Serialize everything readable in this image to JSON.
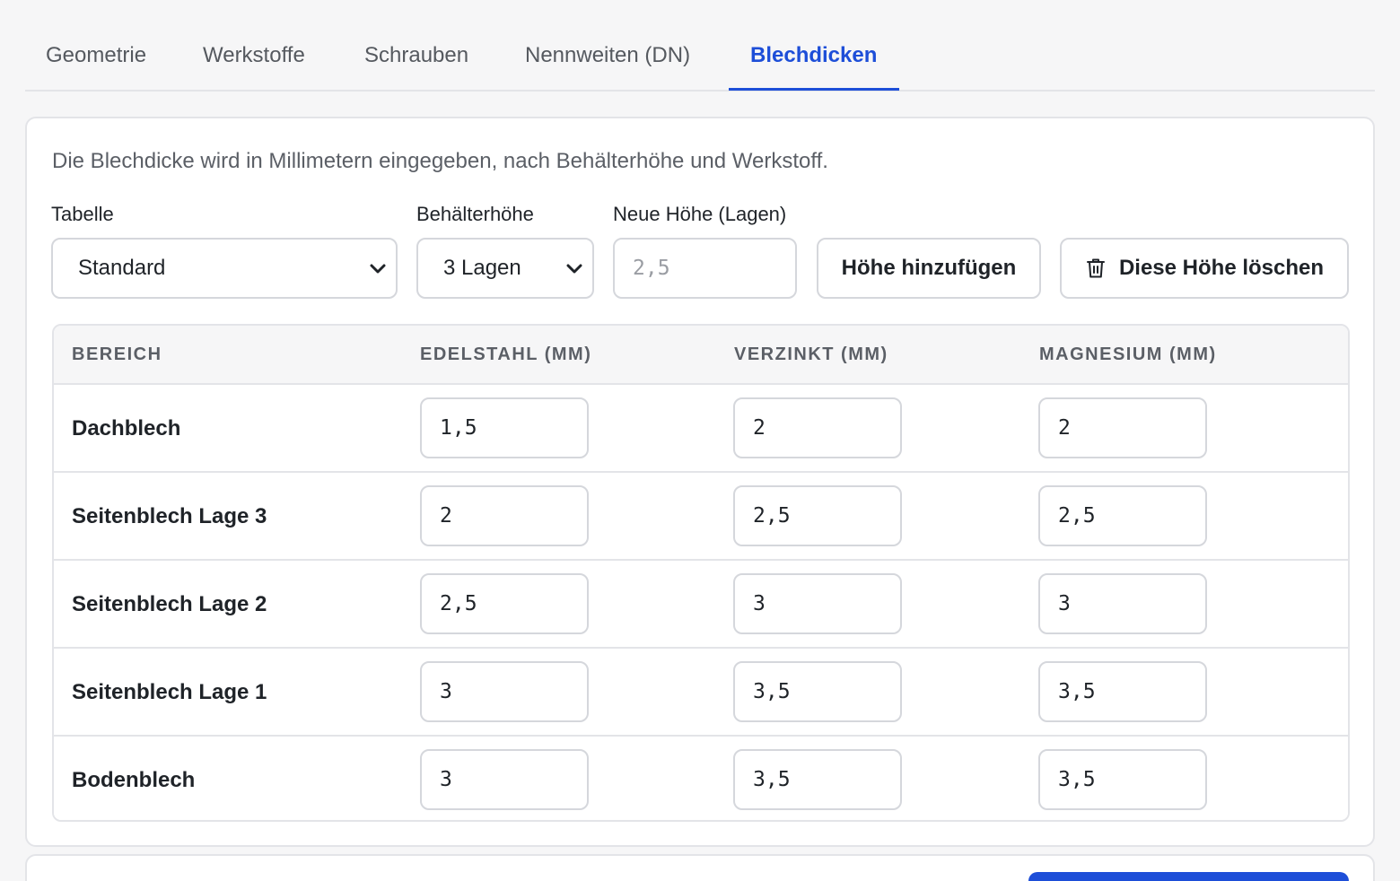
{
  "tabs": [
    {
      "label": "Geometrie",
      "active": false
    },
    {
      "label": "Werkstoffe",
      "active": false
    },
    {
      "label": "Schrauben",
      "active": false
    },
    {
      "label": "Nennweiten (DN)",
      "active": false
    },
    {
      "label": "Blechdicken",
      "active": true
    }
  ],
  "accent_color": "#1d4ed8",
  "description": "Die Blechdicke wird in Millimetern eingegeben, nach Behälterhöhe und Werkstoff.",
  "controls": {
    "table_label": "Tabelle",
    "table_value": "Standard",
    "height_label": "Behälterhöhe",
    "height_value": "3 Lagen",
    "new_height_label": "Neue Höhe (Lagen)",
    "new_height_placeholder": "2,5",
    "add_button": "Höhe hinzufügen",
    "delete_button": "Diese Höhe löschen",
    "delete_icon": "trash-icon"
  },
  "table": {
    "headers": [
      "BEREICH",
      "EDELSTAHL (MM)",
      "VERZINKT (MM)",
      "MAGNESIUM (MM)"
    ],
    "rows": [
      {
        "label": "Dachblech",
        "values": [
          "1,5",
          "2",
          "2"
        ]
      },
      {
        "label": "Seitenblech Lage 3",
        "values": [
          "2",
          "2,5",
          "2,5"
        ]
      },
      {
        "label": "Seitenblech Lage 2",
        "values": [
          "2,5",
          "3",
          "3"
        ]
      },
      {
        "label": "Seitenblech Lage 1",
        "values": [
          "3",
          "3,5",
          "3,5"
        ]
      },
      {
        "label": "Bodenblech",
        "values": [
          "3",
          "3,5",
          "3,5"
        ]
      }
    ]
  }
}
